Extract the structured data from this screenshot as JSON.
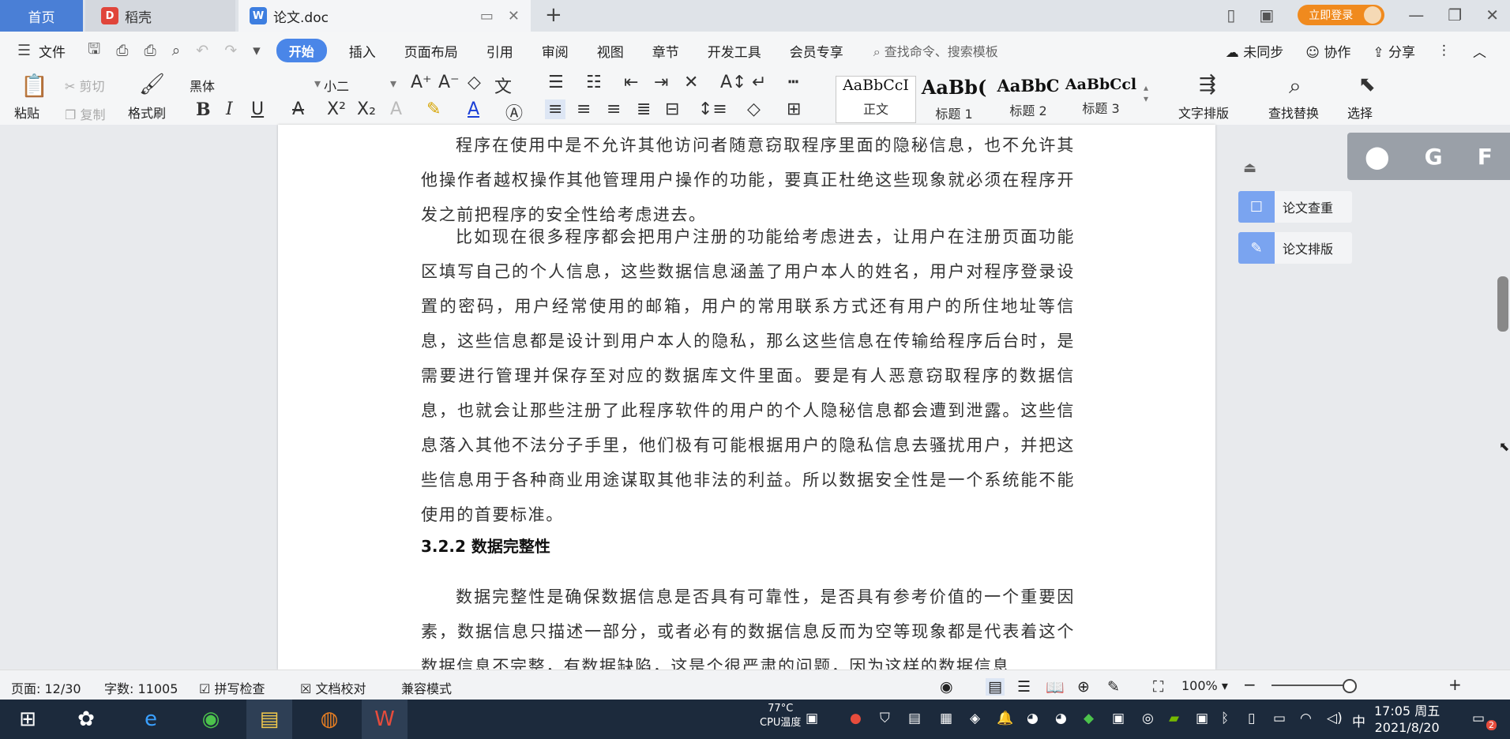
{
  "tabs": {
    "home": "首页",
    "daoke": "稻壳",
    "doc": "论文.doc"
  },
  "window": {
    "login": "立即登录"
  },
  "menu": {
    "file": "文件",
    "items": [
      "开始",
      "插入",
      "页面布局",
      "引用",
      "审阅",
      "视图",
      "章节",
      "开发工具",
      "会员专享"
    ],
    "search_placeholder": "查找命令、搜索模板",
    "sync": "未同步",
    "collab": "协作",
    "share": "分享"
  },
  "ribbon": {
    "paste": "粘贴",
    "cut": "剪切",
    "copy": "复制",
    "format_painter": "格式刷",
    "font": "黑体",
    "size": "小二",
    "styles": [
      {
        "sample": "AaBbCcI",
        "name": "正文"
      },
      {
        "sample": "AaBb(",
        "name": "标题 1"
      },
      {
        "sample": "AaBbC",
        "name": "标题 2"
      },
      {
        "sample": "AaBbCcl",
        "name": "标题 3"
      }
    ],
    "text_layout": "文字排版",
    "find_replace": "查找替换",
    "select": "选择"
  },
  "document": {
    "paragraphs": [
      "程序在使用中是不允许其他访问者随意窃取程序里面的隐秘信息，也不允许其他操作者越权操作其他管理用户操作的功能，要真正杜绝这些现象就必须在程序开发之前把程序的安全性给考虑进去。",
      "比如现在很多程序都会把用户注册的功能给考虑进去，让用户在注册页面功能区填写自己的个人信息，这些数据信息涵盖了用户本人的姓名，用户对程序登录设置的密码，用户经常使用的邮箱，用户的常用联系方式还有用户的所住地址等信息，这些信息都是设计到用户本人的隐私，那么这些信息在传输给程序后台时，是需要进行管理并保存至对应的数据库文件里面。要是有人恶意窃取程序的数据信息，也就会让那些注册了此程序软件的用户的个人隐秘信息都会遭到泄露。这些信息落入其他不法分子手里，他们极有可能根据用户的隐私信息去骚扰用户，并把这些信息用于各种商业用途谋取其他非法的利益。所以数据安全性是一个系统能不能使用的首要标准。",
      "数据完整性是确保数据信息是否具有可靠性，是否具有参考价值的一个重要因素，数据信息只描述一部分，或者必有的数据信息反而为空等现象都是代表着这个数据信息不完整，有数据缺陷，这是个很严肃的问题，因为这样的数据信息"
    ],
    "heading": "3.2.2  数据完整性"
  },
  "side_panel": {
    "check": "论文查重",
    "layout": "论文排版",
    "float_letters": [
      "G",
      "F"
    ]
  },
  "status": {
    "page": "页面: 12/30",
    "words": "字数: 11005",
    "spell": "拼写检查",
    "proof": "文档校对",
    "compat": "兼容模式",
    "zoom": "100%"
  },
  "taskbar": {
    "temp": "77°C",
    "cpu": "CPU温度",
    "ime": "中",
    "time": "17:05 周五",
    "date": "2021/8/20",
    "notif_count": "2"
  }
}
